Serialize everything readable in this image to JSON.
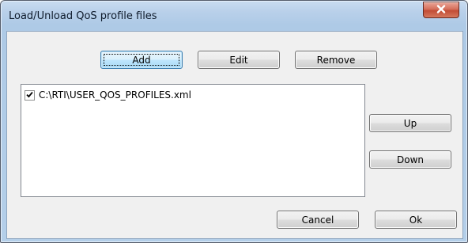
{
  "window": {
    "title": "Load/Unload QoS profile files"
  },
  "toolbar": {
    "add_label": "Add",
    "edit_label": "Edit",
    "remove_label": "Remove"
  },
  "files": [
    {
      "path": "C:\\RTI\\USER_QOS_PROFILES.xml",
      "checked": true
    }
  ],
  "side_buttons": {
    "up_label": "Up",
    "down_label": "Down"
  },
  "footer": {
    "cancel_label": "Cancel",
    "ok_label": "Ok"
  },
  "icons": {
    "close": "close-icon",
    "check": "checkmark-icon"
  },
  "colors": {
    "close_button": "#c9553e",
    "default_button_border": "#3c7fb1",
    "dialog_background": "#f0f0f0"
  }
}
